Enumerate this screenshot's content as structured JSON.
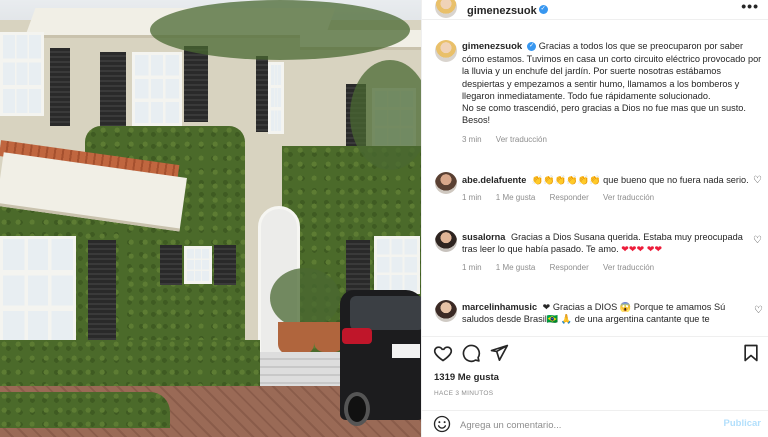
{
  "post": {
    "author": "gimenezsuok",
    "caption_author": "gimenezsuok",
    "caption": "Gracias a todos los que se preocuparon por saber cómo estamos. Tuvimos en casa un corto circuito eléctrico provocado por la lluvia y un enchufe del jardín. Por suerte nosotras estábamos despiertas y empezamos a sentir humo, llamamos a los bomberos y llegaron inmediatamente. Todo fue rápidamente solucionado.",
    "caption_2": "No se como trascendió, pero gracias a Dios no fue mas que un susto. Besos!",
    "caption_time": "3 min",
    "see_translation": "Ver traducción",
    "likes": "1319 Me gusta",
    "posted_ago": "HACE 3 MINUTOS"
  },
  "comments": [
    {
      "user": "abe.delafuente",
      "text": "👏👏👏👏👏👏 que bueno que no fuera nada serio.",
      "time": "1 min",
      "likes": "1 Me gusta",
      "reply": "Responder",
      "translate": "Ver traducción"
    },
    {
      "user": "susalorna",
      "text": "Gracias a Dios Susana querida. Estaba muy preocupada tras leer lo que había pasado. Te amo.",
      "hearts": "❤❤❤ ❤❤",
      "time": "1 min",
      "likes": "1 Me gusta",
      "reply": "Responder",
      "translate": "Ver traducción"
    },
    {
      "user": "marcelinhamusic",
      "text": "❤ Gracias a DIOS 😱 Porque te amamos Sú saludos desde Brasil🇧🇷 🙏 de una argentina cantante que te"
    }
  ],
  "add_comment": {
    "placeholder": "Agrega un comentario...",
    "publish": "Publicar"
  },
  "icons": {
    "like": "heart-icon",
    "comment": "comment-icon",
    "share": "send-icon",
    "save": "bookmark-icon",
    "emoji": "emoji-icon",
    "options": "more-icon"
  },
  "colors": {
    "verified": "#3897f0",
    "red_heart": "#ed1c3a",
    "muted_text": "#8e8e8e",
    "publish_disabled": "#b2dffc"
  }
}
